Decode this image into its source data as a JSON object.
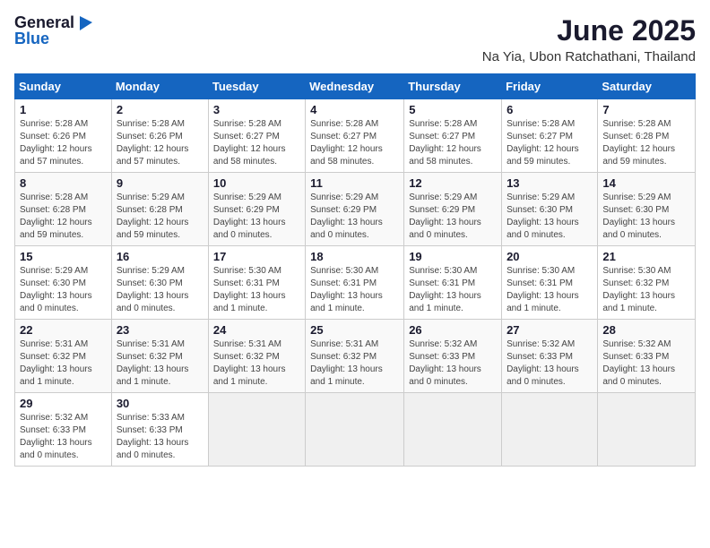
{
  "logo": {
    "general": "General",
    "blue": "Blue"
  },
  "title": "June 2025",
  "subtitle": "Na Yia, Ubon Ratchathani, Thailand",
  "headers": [
    "Sunday",
    "Monday",
    "Tuesday",
    "Wednesday",
    "Thursday",
    "Friday",
    "Saturday"
  ],
  "weeks": [
    [
      {
        "day": "1",
        "info": "Sunrise: 5:28 AM\nSunset: 6:26 PM\nDaylight: 12 hours\nand 57 minutes."
      },
      {
        "day": "2",
        "info": "Sunrise: 5:28 AM\nSunset: 6:26 PM\nDaylight: 12 hours\nand 57 minutes."
      },
      {
        "day": "3",
        "info": "Sunrise: 5:28 AM\nSunset: 6:27 PM\nDaylight: 12 hours\nand 58 minutes."
      },
      {
        "day": "4",
        "info": "Sunrise: 5:28 AM\nSunset: 6:27 PM\nDaylight: 12 hours\nand 58 minutes."
      },
      {
        "day": "5",
        "info": "Sunrise: 5:28 AM\nSunset: 6:27 PM\nDaylight: 12 hours\nand 58 minutes."
      },
      {
        "day": "6",
        "info": "Sunrise: 5:28 AM\nSunset: 6:27 PM\nDaylight: 12 hours\nand 59 minutes."
      },
      {
        "day": "7",
        "info": "Sunrise: 5:28 AM\nSunset: 6:28 PM\nDaylight: 12 hours\nand 59 minutes."
      }
    ],
    [
      {
        "day": "8",
        "info": "Sunrise: 5:28 AM\nSunset: 6:28 PM\nDaylight: 12 hours\nand 59 minutes."
      },
      {
        "day": "9",
        "info": "Sunrise: 5:29 AM\nSunset: 6:28 PM\nDaylight: 12 hours\nand 59 minutes."
      },
      {
        "day": "10",
        "info": "Sunrise: 5:29 AM\nSunset: 6:29 PM\nDaylight: 13 hours\nand 0 minutes."
      },
      {
        "day": "11",
        "info": "Sunrise: 5:29 AM\nSunset: 6:29 PM\nDaylight: 13 hours\nand 0 minutes."
      },
      {
        "day": "12",
        "info": "Sunrise: 5:29 AM\nSunset: 6:29 PM\nDaylight: 13 hours\nand 0 minutes."
      },
      {
        "day": "13",
        "info": "Sunrise: 5:29 AM\nSunset: 6:30 PM\nDaylight: 13 hours\nand 0 minutes."
      },
      {
        "day": "14",
        "info": "Sunrise: 5:29 AM\nSunset: 6:30 PM\nDaylight: 13 hours\nand 0 minutes."
      }
    ],
    [
      {
        "day": "15",
        "info": "Sunrise: 5:29 AM\nSunset: 6:30 PM\nDaylight: 13 hours\nand 0 minutes."
      },
      {
        "day": "16",
        "info": "Sunrise: 5:29 AM\nSunset: 6:30 PM\nDaylight: 13 hours\nand 0 minutes."
      },
      {
        "day": "17",
        "info": "Sunrise: 5:30 AM\nSunset: 6:31 PM\nDaylight: 13 hours\nand 1 minute."
      },
      {
        "day": "18",
        "info": "Sunrise: 5:30 AM\nSunset: 6:31 PM\nDaylight: 13 hours\nand 1 minute."
      },
      {
        "day": "19",
        "info": "Sunrise: 5:30 AM\nSunset: 6:31 PM\nDaylight: 13 hours\nand 1 minute."
      },
      {
        "day": "20",
        "info": "Sunrise: 5:30 AM\nSunset: 6:31 PM\nDaylight: 13 hours\nand 1 minute."
      },
      {
        "day": "21",
        "info": "Sunrise: 5:30 AM\nSunset: 6:32 PM\nDaylight: 13 hours\nand 1 minute."
      }
    ],
    [
      {
        "day": "22",
        "info": "Sunrise: 5:31 AM\nSunset: 6:32 PM\nDaylight: 13 hours\nand 1 minute."
      },
      {
        "day": "23",
        "info": "Sunrise: 5:31 AM\nSunset: 6:32 PM\nDaylight: 13 hours\nand 1 minute."
      },
      {
        "day": "24",
        "info": "Sunrise: 5:31 AM\nSunset: 6:32 PM\nDaylight: 13 hours\nand 1 minute."
      },
      {
        "day": "25",
        "info": "Sunrise: 5:31 AM\nSunset: 6:32 PM\nDaylight: 13 hours\nand 1 minute."
      },
      {
        "day": "26",
        "info": "Sunrise: 5:32 AM\nSunset: 6:33 PM\nDaylight: 13 hours\nand 0 minutes."
      },
      {
        "day": "27",
        "info": "Sunrise: 5:32 AM\nSunset: 6:33 PM\nDaylight: 13 hours\nand 0 minutes."
      },
      {
        "day": "28",
        "info": "Sunrise: 5:32 AM\nSunset: 6:33 PM\nDaylight: 13 hours\nand 0 minutes."
      }
    ],
    [
      {
        "day": "29",
        "info": "Sunrise: 5:32 AM\nSunset: 6:33 PM\nDaylight: 13 hours\nand 0 minutes."
      },
      {
        "day": "30",
        "info": "Sunrise: 5:33 AM\nSunset: 6:33 PM\nDaylight: 13 hours\nand 0 minutes."
      },
      {
        "day": "",
        "info": ""
      },
      {
        "day": "",
        "info": ""
      },
      {
        "day": "",
        "info": ""
      },
      {
        "day": "",
        "info": ""
      },
      {
        "day": "",
        "info": ""
      }
    ]
  ]
}
